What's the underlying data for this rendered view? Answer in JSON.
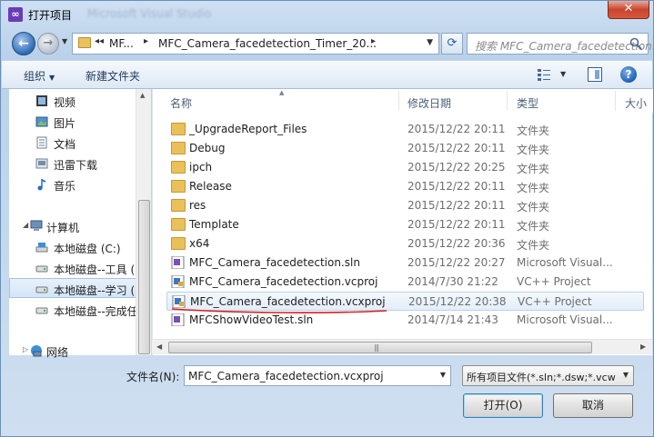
{
  "window": {
    "title": "打开项目",
    "ghost_title_left": "Microsoft Visual Studio",
    "ghost_title_right": "",
    "close_glyph": "✕"
  },
  "address": {
    "segments": [
      "MF...",
      "MFC_Camera_facedetection_Timer_20..."
    ],
    "search_placeholder": "搜索 MFC_Camera_facedetection..."
  },
  "toolbar": {
    "organize_label": "组织",
    "new_folder_label": "新建文件夹"
  },
  "nav": {
    "items": [
      {
        "label": "视频",
        "icon": "video-library-icon"
      },
      {
        "label": "图片",
        "icon": "pictures-library-icon"
      },
      {
        "label": "文档",
        "icon": "documents-library-icon"
      },
      {
        "label": "迅雷下载",
        "icon": "download-folder-icon"
      },
      {
        "label": "音乐",
        "icon": "music-library-icon"
      },
      {
        "label": "计算机",
        "icon": "computer-icon"
      },
      {
        "label": "本地磁盘 (C:)",
        "icon": "system-drive-icon"
      },
      {
        "label": "本地磁盘--工具 (",
        "icon": "drive-icon"
      },
      {
        "label": "本地磁盘--学习 (",
        "icon": "drive-icon"
      },
      {
        "label": "本地磁盘--完成任",
        "icon": "drive-icon"
      },
      {
        "label": "网络",
        "icon": "network-icon"
      }
    ]
  },
  "columns": {
    "name": "名称",
    "date": "修改日期",
    "type": "类型",
    "size": "大小"
  },
  "files": [
    {
      "name": "_UpgradeReport_Files",
      "date": "2015/12/22 20:11",
      "type": "文件夹",
      "kind": "folder"
    },
    {
      "name": "Debug",
      "date": "2015/12/22 20:11",
      "type": "文件夹",
      "kind": "folder"
    },
    {
      "name": "ipch",
      "date": "2015/12/22 20:25",
      "type": "文件夹",
      "kind": "folder"
    },
    {
      "name": "Release",
      "date": "2015/12/22 20:11",
      "type": "文件夹",
      "kind": "folder"
    },
    {
      "name": "res",
      "date": "2015/12/22 20:11",
      "type": "文件夹",
      "kind": "folder"
    },
    {
      "name": "Template",
      "date": "2015/12/22 20:11",
      "type": "文件夹",
      "kind": "folder"
    },
    {
      "name": "x64",
      "date": "2015/12/22 20:36",
      "type": "文件夹",
      "kind": "folder"
    },
    {
      "name": "MFC_Camera_facedetection.sln",
      "date": "2015/12/22 20:27",
      "type": "Microsoft Visual...",
      "kind": "sln"
    },
    {
      "name": "MFC_Camera_facedetection.vcproj",
      "date": "2014/7/30 21:22",
      "type": "VC++ Project",
      "kind": "vcproj"
    },
    {
      "name": "MFC_Camera_facedetection.vcxproj",
      "date": "2015/12/22 20:38",
      "type": "VC++ Project",
      "kind": "vcxproj"
    },
    {
      "name": "MFCShowVideoTest.sln",
      "date": "2014/7/14 21:43",
      "type": "Microsoft Visual...",
      "kind": "sln"
    }
  ],
  "bottom": {
    "filename_label": "文件名(N):",
    "filename_value": "MFC_Camera_facedetection.vcxproj",
    "filter_value": "所有项目文件(*.sln;*.dsw;*.vcw",
    "open_label": "打开(O)",
    "cancel_label": "取消"
  },
  "colors": {
    "annotation_red": "#d81e1e",
    "folder": "#eac05a",
    "selection_blue": "#b8d3f0"
  }
}
